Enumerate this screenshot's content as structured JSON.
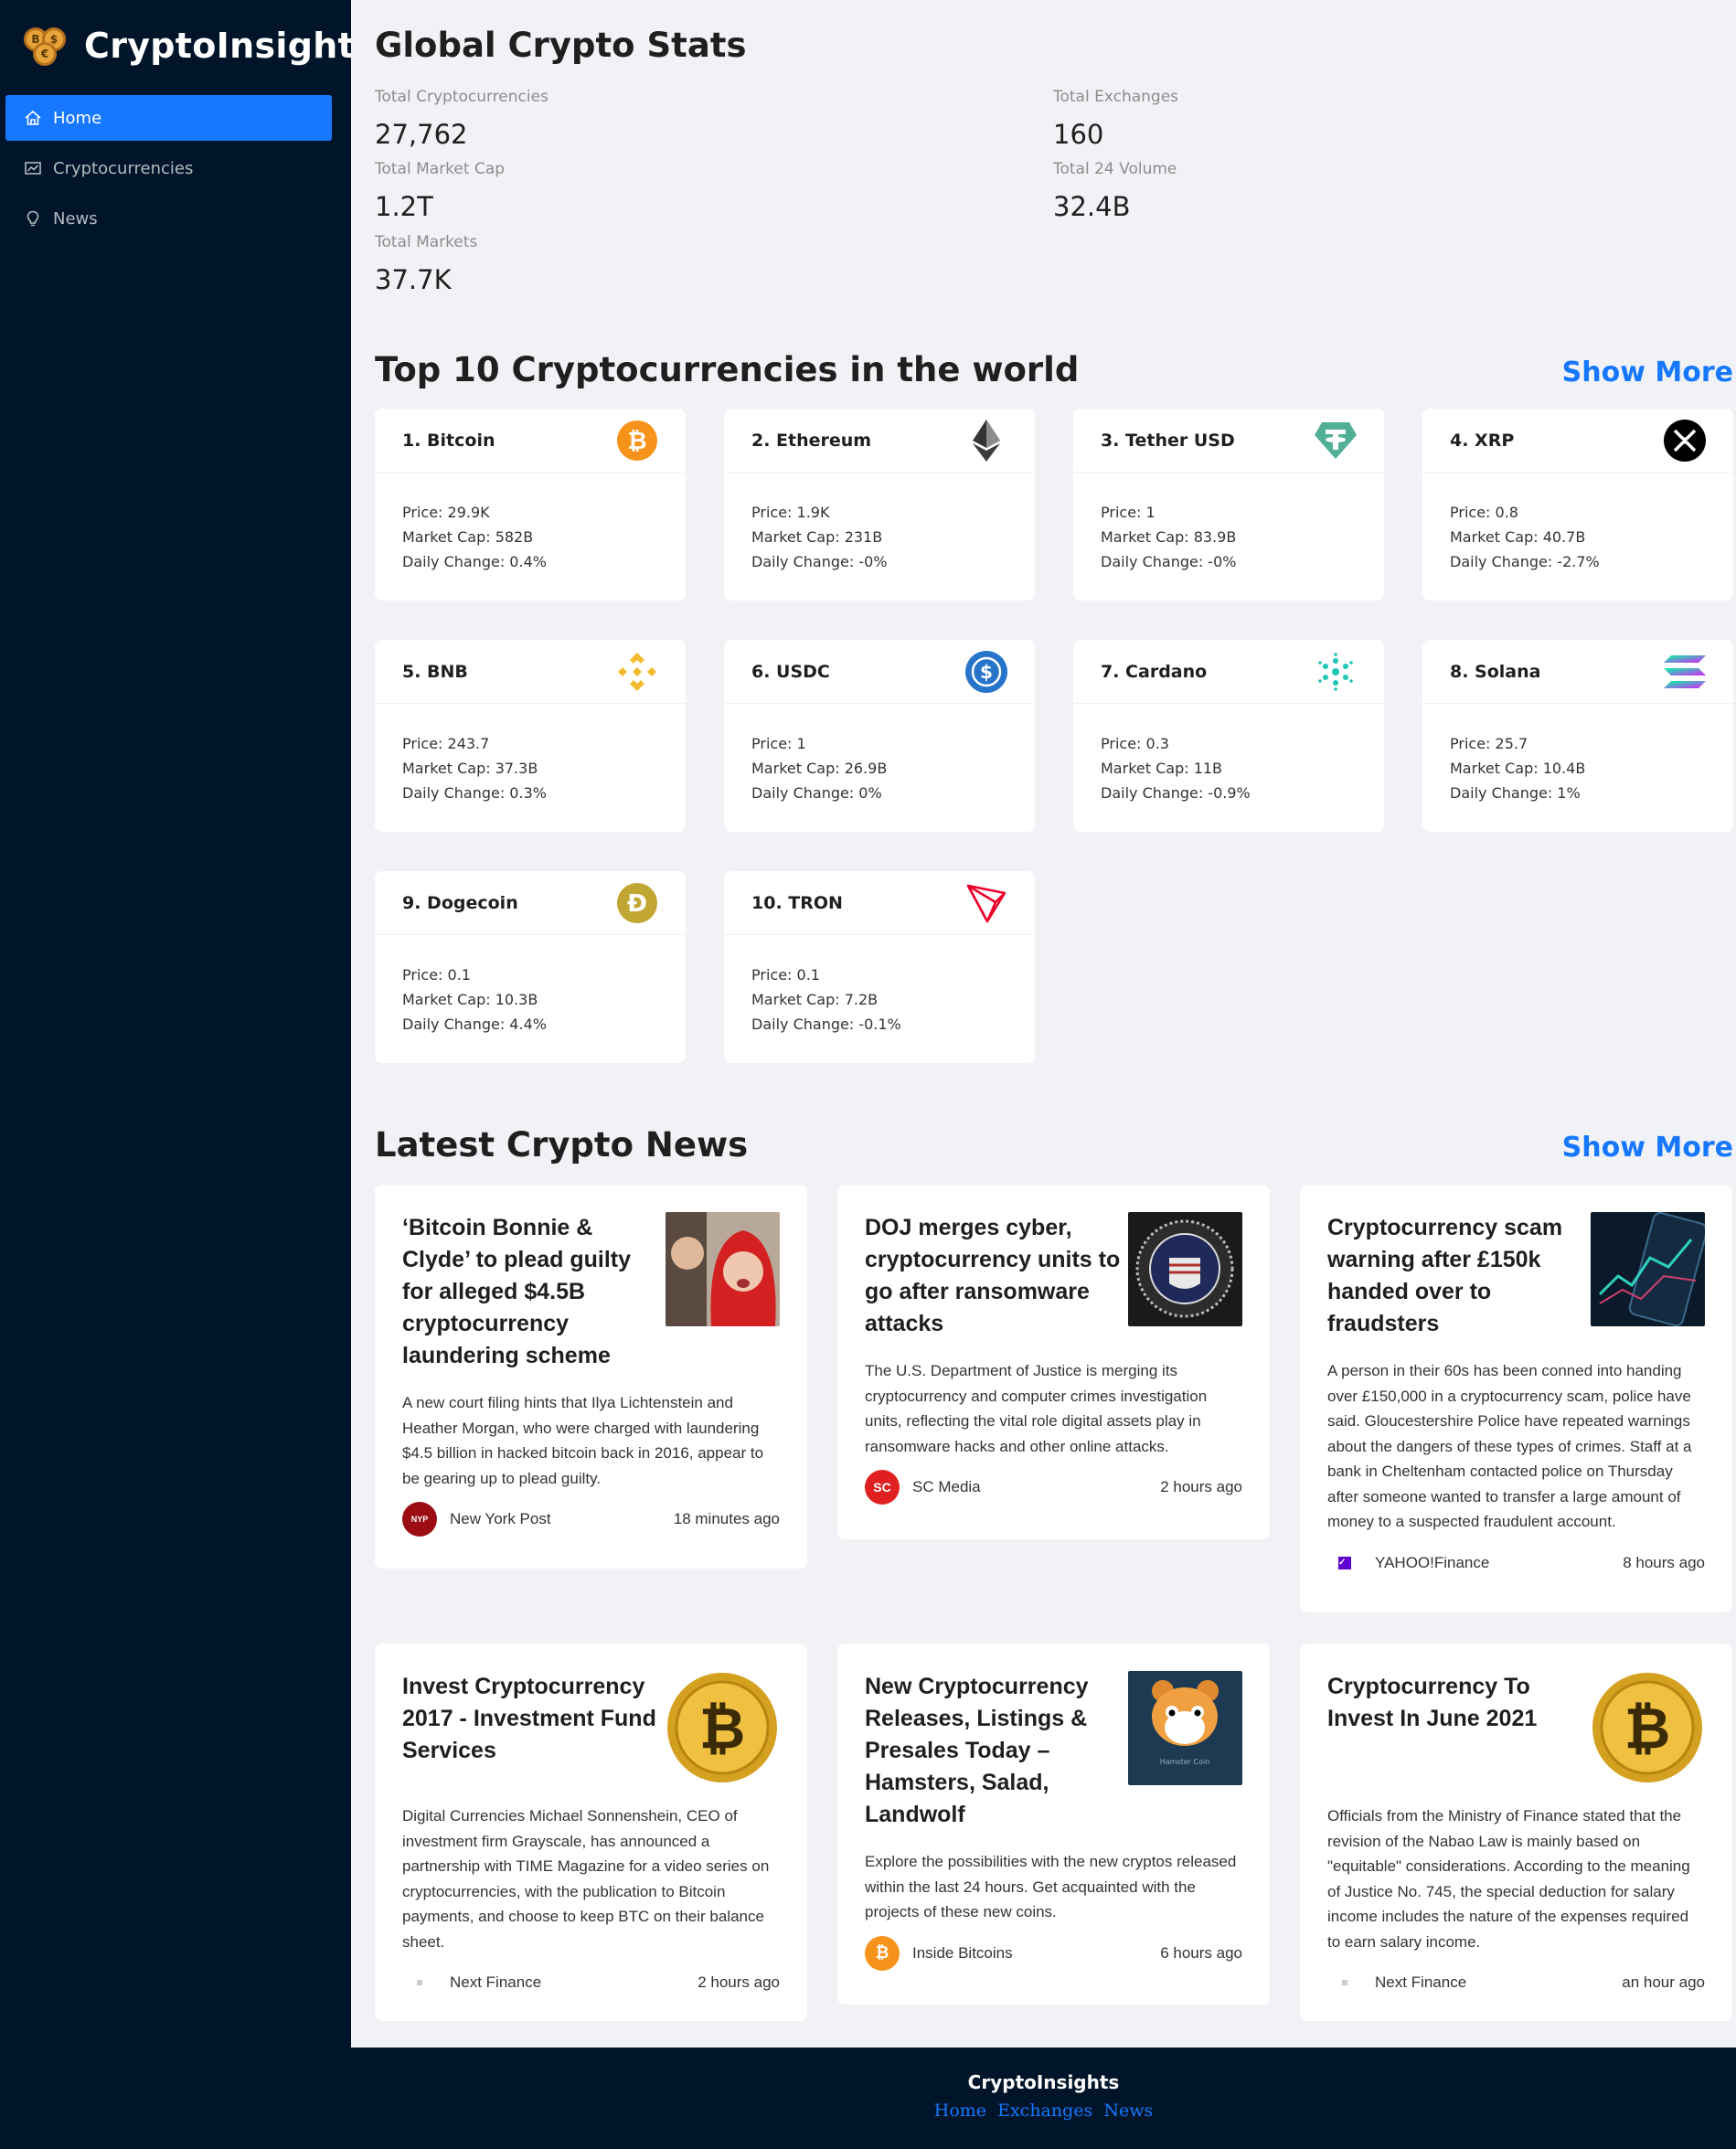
{
  "sidebar": {
    "brand": "CryptoInsights",
    "menu": [
      {
        "label": "Home",
        "icon": "home-icon"
      },
      {
        "label": "Cryptocurrencies",
        "icon": "fund-icon"
      },
      {
        "label": "News",
        "icon": "bulb-icon"
      }
    ]
  },
  "stats": {
    "title": "Global Crypto Stats",
    "total_cryptocurrencies_label": "Total Cryptocurrencies",
    "total_cryptocurrencies": "27,762",
    "total_exchanges_label": "Total Exchanges",
    "total_exchanges": "160",
    "total_market_cap_label": "Total Market Cap",
    "total_market_cap": "1.2T",
    "total_24_volume_label": "Total 24 Volume",
    "total_24_volume": "32.4B",
    "total_markets_label": "Total Markets",
    "total_markets": "37.7K"
  },
  "top10": {
    "title": "Top 10 Cryptocurrencies in the world",
    "show_more": "Show More",
    "coins": [
      {
        "name": "1. Bitcoin",
        "price": "Price: 29.9K",
        "cap": "Market Cap: 582B",
        "change": "Daily Change: 0.4%",
        "icon": "bitcoin-icon",
        "color": "#f7931a"
      },
      {
        "name": "2. Ethereum",
        "price": "Price: 1.9K",
        "cap": "Market Cap: 231B",
        "change": "Daily Change: -0%",
        "icon": "ethereum-icon",
        "color": "#343434"
      },
      {
        "name": "3. Tether USD",
        "price": "Price: 1",
        "cap": "Market Cap: 83.9B",
        "change": "Daily Change: -0%",
        "icon": "tether-icon",
        "color": "#50af95"
      },
      {
        "name": "4. XRP",
        "price": "Price: 0.8",
        "cap": "Market Cap: 40.7B",
        "change": "Daily Change: -2.7%",
        "icon": "xrp-icon",
        "color": "#000000"
      },
      {
        "name": "5. BNB",
        "price": "Price: 243.7",
        "cap": "Market Cap: 37.3B",
        "change": "Daily Change: 0.3%",
        "icon": "bnb-icon",
        "color": "#f3ba2f"
      },
      {
        "name": "6. USDC",
        "price": "Price: 1",
        "cap": "Market Cap: 26.9B",
        "change": "Daily Change: 0%",
        "icon": "usdc-icon",
        "color": "#2775ca"
      },
      {
        "name": "7. Cardano",
        "price": "Price: 0.3",
        "cap": "Market Cap: 11B",
        "change": "Daily Change: -0.9%",
        "icon": "cardano-icon",
        "color": "#1ec7b6"
      },
      {
        "name": "8. Solana",
        "price": "Price: 25.7",
        "cap": "Market Cap: 10.4B",
        "change": "Daily Change: 1%",
        "icon": "solana-icon",
        "color": "#9945ff"
      },
      {
        "name": "9. Dogecoin",
        "price": "Price: 0.1",
        "cap": "Market Cap: 10.3B",
        "change": "Daily Change: 4.4%",
        "icon": "dogecoin-icon",
        "color": "#c2a633"
      },
      {
        "name": "10. TRON",
        "price": "Price: 0.1",
        "cap": "Market Cap: 7.2B",
        "change": "Daily Change: -0.1%",
        "icon": "tron-icon",
        "color": "#eb0029"
      }
    ]
  },
  "news": {
    "title": "Latest Crypto News",
    "show_more": "Show More",
    "items": [
      {
        "title": "‘Bitcoin Bonnie & Clyde’ to plead guilty for alleged $4.5B cryptocurrency laundering scheme",
        "desc": "A new court filing hints that Ilya Lichtenstein and Heather Morgan, who were charged with laundering $4.5 billion in hacked bitcoin back in 2016, appear to be gearing up to plead guilty.",
        "provider": "New York Post",
        "time": "18 minutes ago",
        "image": "couple-photo"
      },
      {
        "title": "DOJ merges cyber, cryptocurrency units to go after ransomware attacks",
        "desc": "The U.S. Department of Justice is merging its cryptocurrency and computer crimes investigation units, reflecting the vital role digital assets play in ransomware hacks and other online attacks.",
        "provider": "SC Media",
        "time": "2 hours ago",
        "image": "fbi-seal"
      },
      {
        "title": "Cryptocurrency scam warning after £150k handed over to fraudsters",
        "desc": "A person in their 60s has been conned into handing over £150,000 in a cryptocurrency scam, police have said. Gloucestershire Police have repeated warnings about the dangers of these types of crimes. Staff at a bank in Cheltenham contacted police on Thursday after someone wanted to transfer a large amount of money to a suspected fraudulent account.",
        "provider": "YAHOO!Finance",
        "time": "8 hours ago",
        "image": "phone-chart"
      },
      {
        "title": "Invest Cryptocurrency 2017 - Investment Fund Services",
        "desc": "Digital Currencies Michael Sonnenshein, CEO of investment firm Grayscale, has announced a partnership with TIME Magazine for a video series on cryptocurrencies, with the publication to Bitcoin payments, and choose to keep BTC on their balance sheet.",
        "provider": "Next Finance",
        "time": "2 hours ago",
        "image": "bitcoin-coin"
      },
      {
        "title": "New Cryptocurrency Releases, Listings & Presales Today – Hamsters, Salad, Landwolf",
        "desc": "Explore the possibilities with the new cryptos released within the last 24 hours. Get acquainted with the projects of these new coins.",
        "provider": "Inside Bitcoins",
        "time": "6 hours ago",
        "image": "hamster-coin",
        "image_text": "Hamster Coin"
      },
      {
        "title": "Cryptocurrency To Invest In June 2021",
        "desc": "Officials from the Ministry of Finance stated that the revision of the Nabao Law is mainly based on \"equitable\" considerations. According to the meaning of Justice No. 745, the special deduction for salary income includes the nature of the expenses required to earn salary income.",
        "provider": "Next Finance",
        "time": "an hour ago",
        "image": "bitcoin-coin"
      }
    ]
  },
  "footer": {
    "title": "CryptoInsights",
    "links": [
      "Home",
      "Exchanges",
      "News"
    ]
  }
}
